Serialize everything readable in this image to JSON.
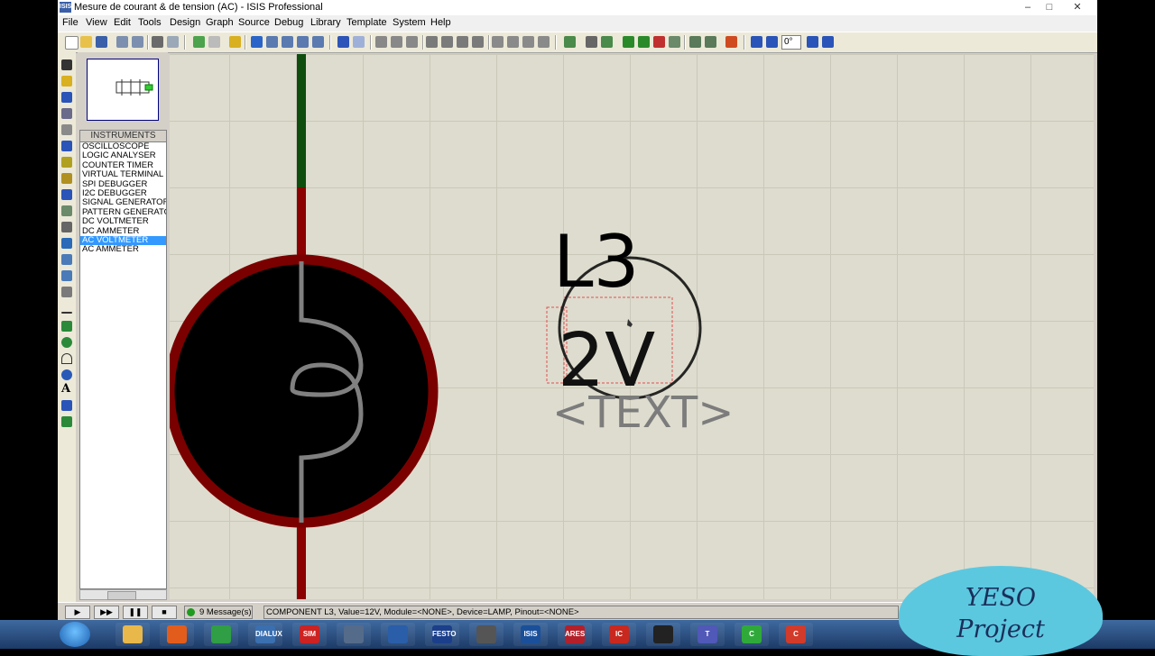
{
  "window": {
    "title": "Mesure de courant & de tension (AC) - ISIS Professional",
    "app_icon_text": "ISIS",
    "controls": [
      "–",
      "□",
      "✕"
    ]
  },
  "menu": [
    "File",
    "View",
    "Edit",
    "Tools",
    "Design",
    "Graph",
    "Source",
    "Debug",
    "Library",
    "Template",
    "System",
    "Help"
  ],
  "toolbar": {
    "angle_value": "0°",
    "icons": [
      "new-icon",
      "open-icon",
      "save-icon",
      "import-icon",
      "export-icon",
      "print-icon",
      "area-icon",
      "redraw-icon",
      "grid-icon",
      "origin-icon",
      "pan-icon",
      "zoom-in-icon",
      "zoom-out-icon",
      "zoom-all-icon",
      "zoom-area-icon",
      "undo-icon",
      "redo-icon",
      "cut-icon",
      "copy-icon",
      "paste-icon",
      "block-copy-icon",
      "block-move-icon",
      "block-rotate-icon",
      "block-delete-icon",
      "pick-device-icon",
      "make-device-icon",
      "packaging-icon",
      "decompose-icon",
      "wire-autoroute-icon",
      "search-icon",
      "property-icon",
      "design-explorer-icon",
      "new-sheet-icon",
      "delete-sheet-icon",
      "goto-sheet-icon",
      "bom-icon",
      "erc-icon",
      "netlist-icon",
      "rotate-cw-icon",
      "rotate-ccw-icon",
      "mirror-x-icon",
      "mirror-y-icon"
    ]
  },
  "left_tools": [
    "selection-icon",
    "component-icon",
    "junction-icon",
    "label-icon",
    "text-script-icon",
    "bus-icon",
    "subcircuit-icon",
    "terminal-icon",
    "pin-icon",
    "graph-icon",
    "tape-icon",
    "generator-icon",
    "probe-voltage-icon",
    "probe-current-icon",
    "instrument-icon",
    "line-icon",
    "box-icon",
    "circle-icon",
    "arc-icon",
    "path-icon",
    "text-icon",
    "symbol-icon",
    "marker-icon"
  ],
  "panel": {
    "header": "INSTRUMENTS",
    "items": [
      "OSCILLOSCOPE",
      "LOGIC ANALYSER",
      "COUNTER TIMER",
      "VIRTUAL TERMINAL",
      "SPI DEBUGGER",
      "I2C DEBUGGER",
      "SIGNAL GENERATOR",
      "PATTERN GENERATOR",
      "DC VOLTMETER",
      "DC AMMETER",
      "AC VOLTMETER",
      "AC AMMETER"
    ],
    "selected_index": 10
  },
  "schematic": {
    "ref": "L3",
    "value": "2V",
    "text_placeholder": "<TEXT>",
    "colors": {
      "wire_green": "#0e4d0e",
      "wire_red": "#8b0000",
      "lamp_ring": "#7a0000",
      "lamp_body": "#000000",
      "filament": "#808080",
      "selection_box": "#e05050"
    }
  },
  "statusbar": {
    "buttons": [
      "▶",
      "▶▶",
      "❚❚",
      "■"
    ],
    "messages": "9 Message(s)",
    "text": "COMPONENT L3, Value=12V, Module=<NONE>, Device=LAMP, Pinout=<NONE>"
  },
  "taskbar": {
    "apps": [
      {
        "name": "explorer",
        "label": "",
        "color": "#e8b84a"
      },
      {
        "name": "firefox",
        "label": "",
        "color": "#e25d1b"
      },
      {
        "name": "chrome",
        "label": "",
        "color": "#2f9e44"
      },
      {
        "name": "isis-sim",
        "label": "DIALUX",
        "color": "#3a6fb0"
      },
      {
        "name": "sim-pro",
        "label": "SIM",
        "color": "#c22"
      },
      {
        "name": "kicad",
        "label": "",
        "color": "#556b8a"
      },
      {
        "name": "plc",
        "label": "",
        "color": "#2a5ea8"
      },
      {
        "name": "festo",
        "label": "FESTO",
        "color": "#1b3f8a"
      },
      {
        "name": "wire",
        "label": "",
        "color": "#555"
      },
      {
        "name": "isis",
        "label": "ISIS",
        "color": "#1a4f9a"
      },
      {
        "name": "ares",
        "label": "ARES",
        "color": "#b3202a"
      },
      {
        "name": "ic",
        "label": "IC",
        "color": "#c8281e"
      },
      {
        "name": "pen",
        "label": "",
        "color": "#222"
      },
      {
        "name": "teams",
        "label": "T",
        "color": "#5058b8"
      },
      {
        "name": "camtasia-green",
        "label": "C",
        "color": "#2faa3a"
      },
      {
        "name": "camtasia-red",
        "label": "C",
        "color": "#d23a2a"
      }
    ]
  },
  "watermark": {
    "line1": "YESO",
    "line2": "Project"
  }
}
